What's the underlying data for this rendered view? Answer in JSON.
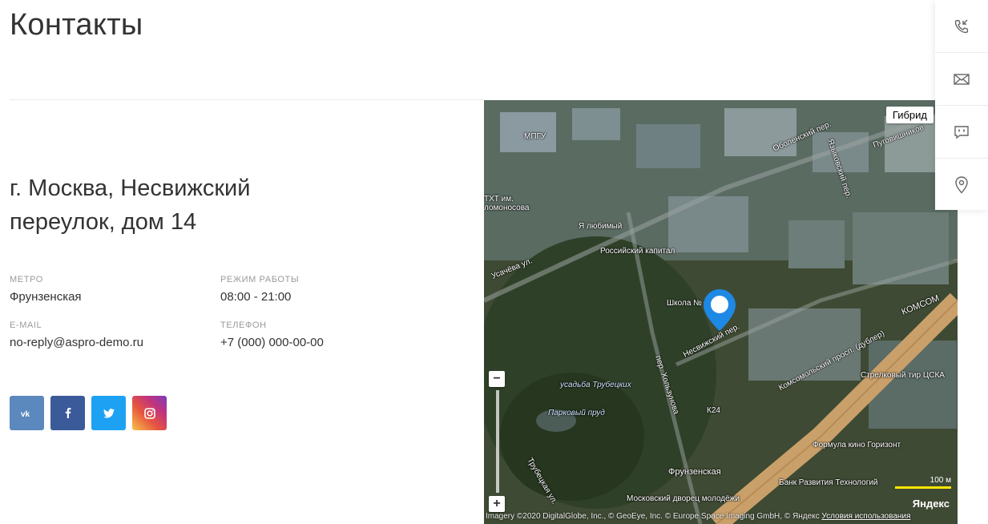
{
  "page": {
    "title": "Контакты"
  },
  "contacts": {
    "address": "г. Москва, Несвижский переулок, дом 14",
    "metro": {
      "label": "МЕТРО",
      "value": "Фрунзенская"
    },
    "hours": {
      "label": "РЕЖИМ РАБОТЫ",
      "value": "08:00 - 21:00"
    },
    "email": {
      "label": "E-MAIL",
      "value": "no-reply@aspro-demo.ru"
    },
    "phone": {
      "label": "ТЕЛЕФОН",
      "value": "+7 (000) 000-00-00"
    }
  },
  "socials": [
    {
      "name": "vk",
      "label": "vk",
      "color": "#5b88bd"
    },
    {
      "name": "facebook",
      "label": "f",
      "color": "#3b5a9a"
    },
    {
      "name": "twitter",
      "label": "twitter",
      "color": "#1da1f2"
    },
    {
      "name": "instagram",
      "label": "instagram",
      "color": "#c1337e"
    }
  ],
  "map": {
    "type_button": "Гибрид",
    "scale_label": "100 м",
    "logo": "Яндекс",
    "copyright": "Imagery ©2020 DigitalGlobe, Inc., © GeoEye, Inc. © Europe Space Imaging GmbH, © Яндекс",
    "terms": "Условия использования",
    "labels": {
      "l1": "МПГУ",
      "l2": "Оболенский пер.",
      "l3": "Языковский пер.",
      "l4": "Пуговишников",
      "l5": "Я любимый",
      "l6": "Российский капитал",
      "l7": "Усачёва ул.",
      "l8": "Школа №",
      "l9": "Несвижский пер.",
      "l10": "Комсомольский просп. (дублер)",
      "l11": "пер. Хользунова",
      "l12": "усадьба Трубецких",
      "l13": "Парковый пруд",
      "l14": "Фрунзенская",
      "l15": "Московский дворец молодёжи",
      "l16": "Банк Развития Технологий",
      "l17": "Формула кино Горизонт",
      "l18": "Стрелковый тир ЦСКА",
      "l19": "К24",
      "l20": "КОМСОМ",
      "l21": "Трубецкая ул.",
      "l22": "ТХТ им. ломоносова"
    }
  },
  "sidebar": {
    "items": [
      {
        "icon": "phone-callback-icon"
      },
      {
        "icon": "mail-icon"
      },
      {
        "icon": "chat-icon"
      },
      {
        "icon": "location-pin-icon"
      }
    ]
  },
  "colors": {
    "text": "#333333",
    "muted": "#9a9a9a",
    "pin": "#1e88e5",
    "road": "#c9a06a"
  }
}
